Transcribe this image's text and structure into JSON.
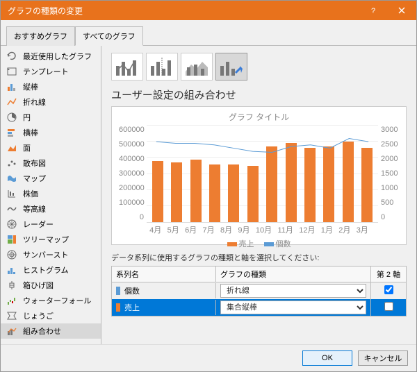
{
  "window": {
    "title": "グラフの種類の変更"
  },
  "tabs": {
    "recommended": "おすすめグラフ",
    "all": "すべてのグラフ"
  },
  "sidebar": {
    "items": [
      {
        "label": "最近使用したグラフ"
      },
      {
        "label": "テンプレート"
      },
      {
        "label": "縦棒"
      },
      {
        "label": "折れ線"
      },
      {
        "label": "円"
      },
      {
        "label": "横棒"
      },
      {
        "label": "面"
      },
      {
        "label": "散布図"
      },
      {
        "label": "マップ"
      },
      {
        "label": "株価"
      },
      {
        "label": "等高線"
      },
      {
        "label": "レーダー"
      },
      {
        "label": "ツリーマップ"
      },
      {
        "label": "サンバースト"
      },
      {
        "label": "ヒストグラム"
      },
      {
        "label": "箱ひげ図"
      },
      {
        "label": "ウォーターフォール"
      },
      {
        "label": "じょうご"
      },
      {
        "label": "組み合わせ"
      }
    ],
    "selected": 18
  },
  "main": {
    "title": "ユーザー設定の組み合わせ",
    "chart_preview_title": "グラフ タイトル",
    "instruction": "データ系列に使用するグラフの種類と軸を選択してください:",
    "headers": {
      "name": "系列名",
      "type": "グラフの種類",
      "axis": "第 2 軸"
    },
    "series": [
      {
        "name": "個数",
        "type": "折れ線",
        "secondary": true,
        "color": "#5b9bd5",
        "selected": false
      },
      {
        "name": "売上",
        "type": "集合縦棒",
        "secondary": false,
        "color": "#ed7d31",
        "selected": true
      }
    ],
    "legend": {
      "s1": "売上",
      "s2": "個数"
    }
  },
  "buttons": {
    "ok": "OK",
    "cancel": "キャンセル"
  },
  "chart_data": {
    "type": "combo",
    "title": "グラフ タイトル",
    "categories": [
      "4月",
      "5月",
      "6月",
      "7月",
      "8月",
      "9月",
      "10月",
      "11月",
      "12月",
      "1月",
      "2月",
      "3月"
    ],
    "series": [
      {
        "name": "売上",
        "type": "bar",
        "axis": "primary",
        "color": "#ed7d31",
        "values": [
          380000,
          370000,
          390000,
          360000,
          360000,
          350000,
          470000,
          490000,
          460000,
          470000,
          500000,
          460000
        ]
      },
      {
        "name": "個数",
        "type": "line",
        "axis": "secondary",
        "color": "#5b9bd5",
        "values": [
          2500,
          2450,
          2450,
          2400,
          2300,
          2200,
          2170,
          2350,
          2400,
          2300,
          2600,
          2500
        ]
      }
    ],
    "ylim": [
      0,
      600000
    ],
    "y2lim": [
      0,
      3000
    ],
    "y_ticks": [
      0,
      100000,
      200000,
      300000,
      400000,
      500000,
      600000
    ],
    "y2_ticks": [
      0,
      500,
      1000,
      1500,
      2000,
      2500,
      3000
    ]
  }
}
